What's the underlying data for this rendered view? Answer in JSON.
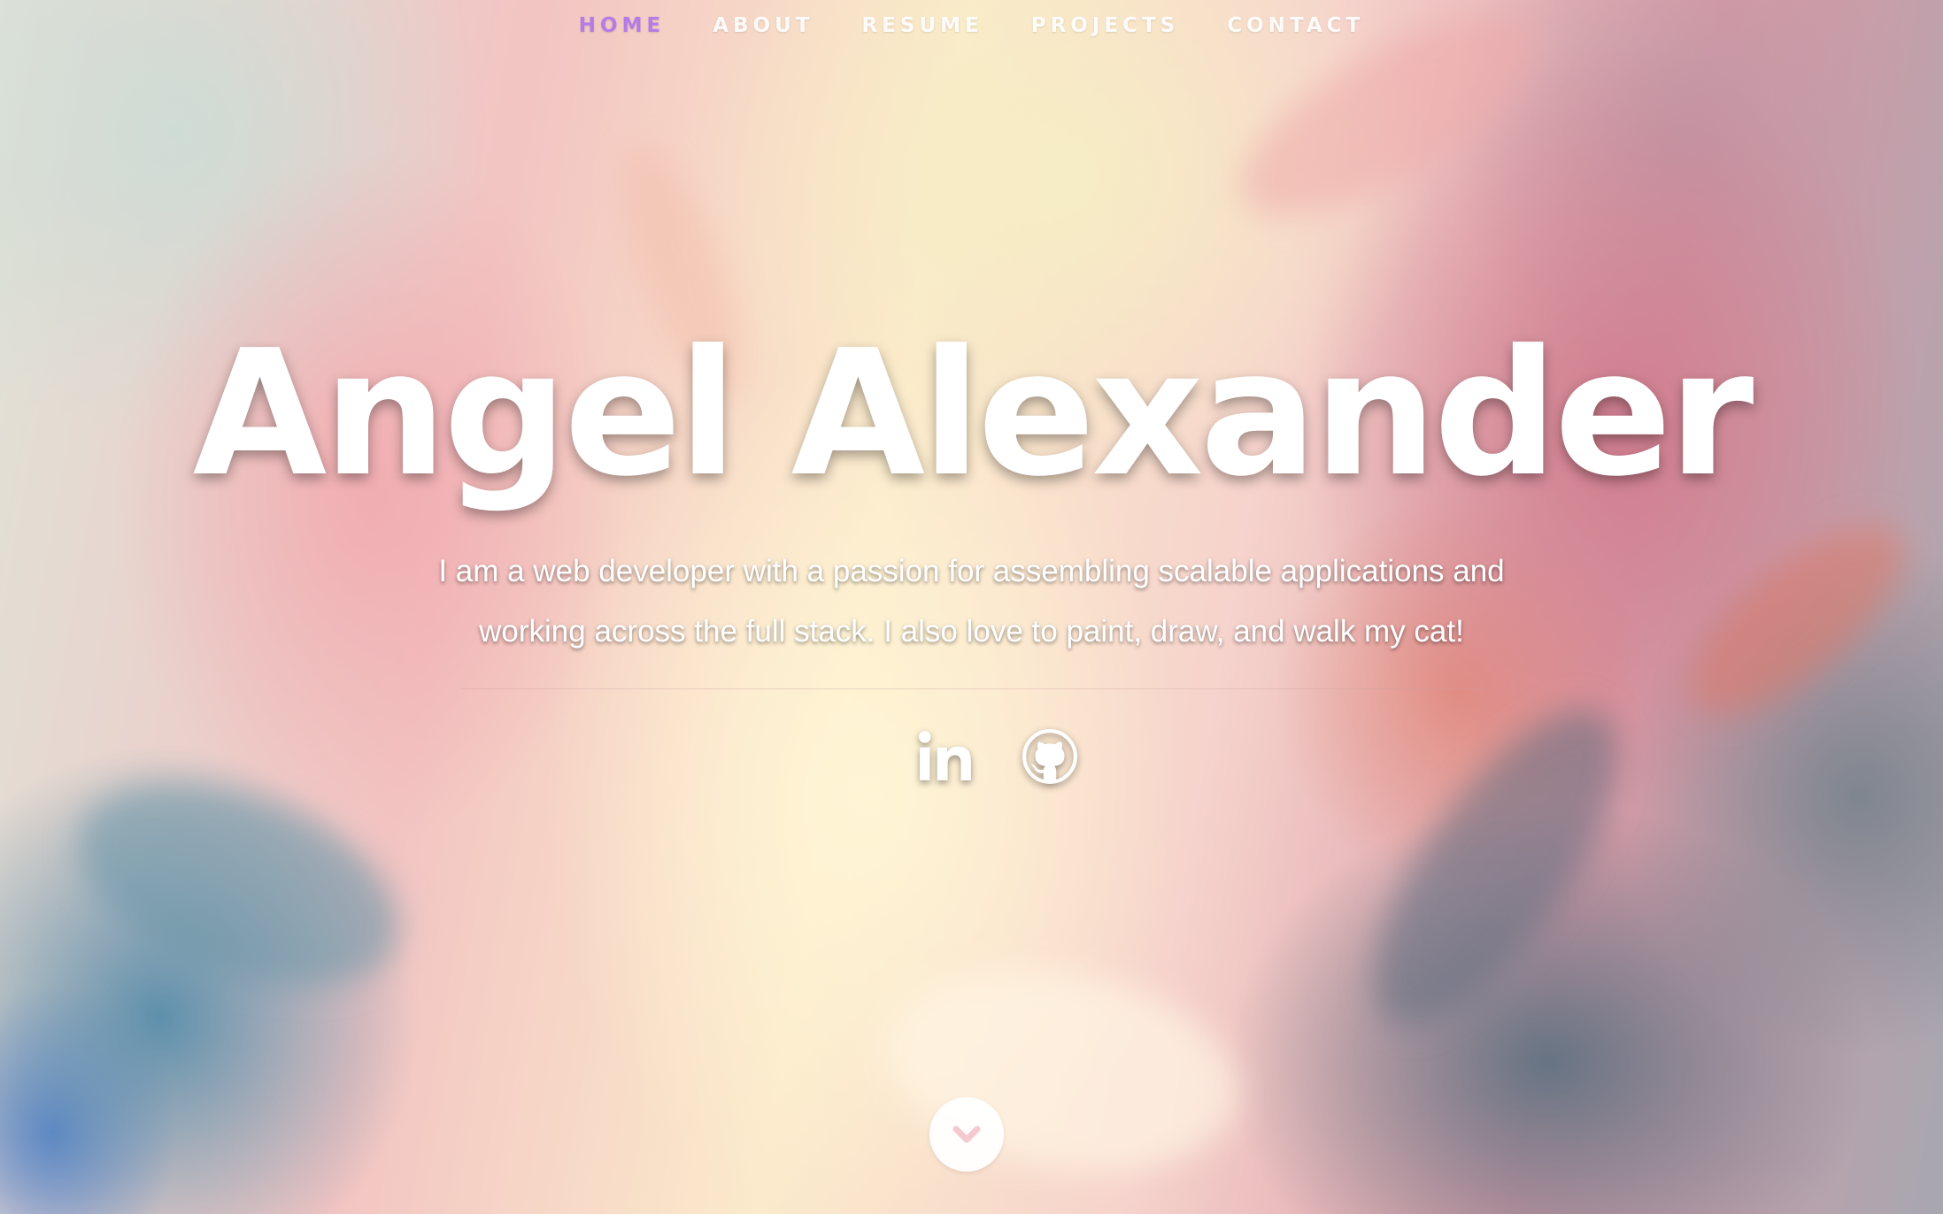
{
  "nav": {
    "items": [
      {
        "label": "HOME",
        "active": true
      },
      {
        "label": "ABOUT",
        "active": false
      },
      {
        "label": "RESUME",
        "active": false
      },
      {
        "label": "PROJECTS",
        "active": false
      },
      {
        "label": "CONTACT",
        "active": false
      }
    ],
    "active_color": "#b57ce6"
  },
  "hero": {
    "name": "Angel Alexander",
    "intro": "I am a web developer with a passion for assembling scalable applications and working across the full stack. I also love to paint, draw, and walk my cat!"
  },
  "social": {
    "icons": [
      "linkedin-icon",
      "github-icon"
    ]
  },
  "scroll": {
    "icon": "chevron-down-icon"
  }
}
